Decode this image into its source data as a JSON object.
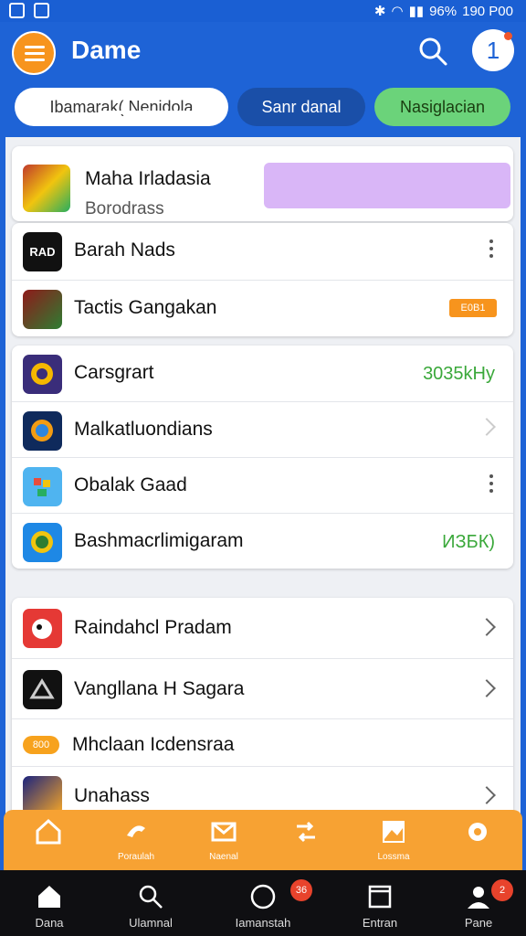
{
  "status_bar": {
    "battery": "96%",
    "time": "190 P00"
  },
  "header": {
    "title": "Dame",
    "avatar_initial": "1"
  },
  "tabs": [
    {
      "label": "Ibamarak( Nenidola"
    },
    {
      "label": "Sanr danal"
    },
    {
      "label": "Nasiglacian"
    }
  ],
  "featured": {
    "title": "Maha Irladasia",
    "subtitle": "Borodrass"
  },
  "group1": [
    {
      "label": "Barah Nads",
      "icon_text": "RAD"
    },
    {
      "label": "Tactis Gangakan",
      "tag": "E0B1"
    }
  ],
  "group2": [
    {
      "label": "Carsgrart",
      "value": "3035kHy"
    },
    {
      "label": "Malkatluondians"
    },
    {
      "label": "Obalak Gaad"
    },
    {
      "label": "Bashmacrlimigaram",
      "value": "ИЗБК)"
    }
  ],
  "group3": [
    {
      "label": "Raindahcl Pradam"
    },
    {
      "label": "Vangllana H Sagara"
    },
    {
      "label": "Mhclaan Icdensraa",
      "pill": "800"
    },
    {
      "label": "Unahass"
    }
  ],
  "action_bar": [
    {
      "label": ""
    },
    {
      "label": "Poraulah"
    },
    {
      "label": "Naenal"
    },
    {
      "label": ""
    },
    {
      "label": "Lossma"
    },
    {
      "label": ""
    }
  ],
  "nav": [
    {
      "label": "Dana"
    },
    {
      "label": "Ulamnal"
    },
    {
      "label": "Iamanstah",
      "badge": "36"
    },
    {
      "label": "Entran"
    },
    {
      "label": "Pane",
      "badge": "2"
    }
  ],
  "colors": {
    "primary": "#1e63d6",
    "accent": "#f7941d",
    "green_tab": "#6bd37a",
    "value_green": "#3aa83a"
  }
}
